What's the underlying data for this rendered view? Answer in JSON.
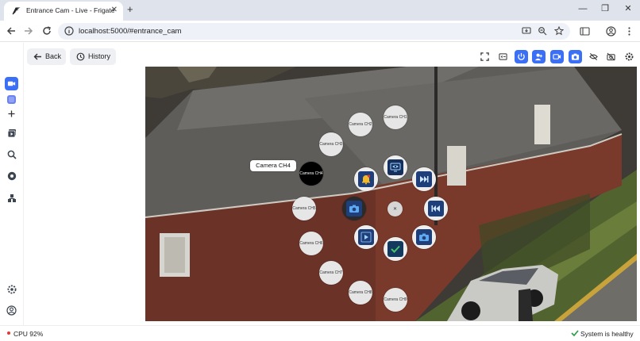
{
  "browser": {
    "tab_title": "Entrance Cam - Live - Frigate",
    "url": "localhost:5000/#entrance_cam",
    "new_tab": "+",
    "tab_close": "✕",
    "window_min": "—",
    "window_restore": "❐",
    "window_close": "✕"
  },
  "header": {
    "back_label": "Back",
    "history_label": "History"
  },
  "sidebar": {
    "items": [
      {
        "icon": "video-icon",
        "active": true
      },
      {
        "icon": "camera-group-icon",
        "active": false
      },
      {
        "icon": "plus-icon",
        "active": false
      },
      {
        "icon": "review-icon",
        "active": false
      },
      {
        "icon": "explore-icon",
        "active": false
      },
      {
        "icon": "export-icon",
        "active": false
      },
      {
        "icon": "system-icon",
        "active": false
      }
    ],
    "bottom": [
      {
        "icon": "settings-icon"
      },
      {
        "icon": "account-icon"
      }
    ]
  },
  "controls": [
    {
      "icon": "fullscreen-icon",
      "active": false
    },
    {
      "icon": "picture-in-picture-icon",
      "active": false
    },
    {
      "icon": "power-icon",
      "active": true
    },
    {
      "icon": "person-detect-icon",
      "active": true
    },
    {
      "icon": "record-icon",
      "active": true
    },
    {
      "icon": "snapshot-icon",
      "active": true
    },
    {
      "icon": "audio-off-icon",
      "active": false
    },
    {
      "icon": "autotrack-icon",
      "active": false
    },
    {
      "icon": "settings-gear-icon",
      "active": false
    }
  ],
  "radial_menu": {
    "tooltip": "Camera CH4",
    "cameras": [
      "Camera CH1",
      "Camera CH2",
      "Camera CH3",
      "Camera CH4",
      "Camera CH5",
      "Camera CH6",
      "Camera CH7",
      "Camera CH8",
      "Camera CH9"
    ],
    "active_camera": "Camera CH4",
    "center_label": "✕",
    "actions": [
      "bell-icon",
      "monitor-eye-icon",
      "skip-forward-icon",
      "skip-back-icon",
      "snapshot-icon",
      "record-camera-icon",
      "checkmark-icon",
      "play-icon"
    ]
  },
  "status": {
    "cpu": "CPU 92%",
    "health": "System is healthy"
  },
  "colors": {
    "accent": "#3b6ff5",
    "cpu_dot": "#e53935",
    "health": "#2e9e47"
  }
}
